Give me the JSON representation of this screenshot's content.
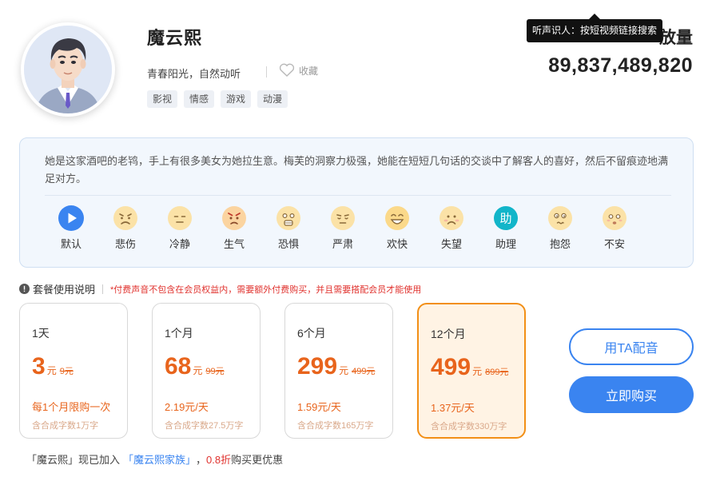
{
  "profile": {
    "name": "魔云熙",
    "tagline": "青春阳光，自然动听",
    "favorite_label": "收藏",
    "tags": [
      "影视",
      "情感",
      "游戏",
      "动漫"
    ]
  },
  "stats": {
    "plays_label": "放量",
    "plays_count": "89,837,489,820"
  },
  "tooltip": {
    "text": "听声识人：按短视频链接搜索"
  },
  "description": {
    "text": "她是这家酒吧的老鸨，手上有很多美女为她拉生意。梅芙的洞察力极强，她能在短短几句话的交谈中了解客人的喜好，然后不留痕迹地满足对方。"
  },
  "emotions": [
    {
      "label": "默认",
      "icon": "play-icon"
    },
    {
      "label": "悲伤",
      "icon": "sad-face-icon"
    },
    {
      "label": "冷静",
      "icon": "calm-face-icon"
    },
    {
      "label": "生气",
      "icon": "angry-face-icon"
    },
    {
      "label": "恐惧",
      "icon": "fear-face-icon"
    },
    {
      "label": "严肃",
      "icon": "serious-face-icon"
    },
    {
      "label": "欢快",
      "icon": "happy-face-icon"
    },
    {
      "label": "失望",
      "icon": "disappointed-face-icon"
    },
    {
      "label": "助理",
      "icon": "assistant-icon",
      "glyph": "助"
    },
    {
      "label": "抱怨",
      "icon": "complain-face-icon"
    },
    {
      "label": "不安",
      "icon": "uneasy-face-icon"
    }
  ],
  "package_notice": {
    "title": "套餐使用说明",
    "note": "*付费声音不包含在会员权益内，需要额外付费购买，并且需要搭配会员才能使用"
  },
  "plans": [
    {
      "name": "1天",
      "price": "3",
      "unit": "元",
      "original": "9元",
      "daily": "每1个月限购一次",
      "chars": "含合成字数1万字",
      "selected": false
    },
    {
      "name": "1个月",
      "price": "68",
      "unit": "元",
      "original": "99元",
      "daily": "2.19元/天",
      "chars": "含合成字数27.5万字",
      "selected": false
    },
    {
      "name": "6个月",
      "price": "299",
      "unit": "元",
      "original": "499元",
      "daily": "1.59元/天",
      "chars": "含合成字数165万字",
      "selected": false
    },
    {
      "name": "12个月",
      "price": "499",
      "unit": "元",
      "original": "899元",
      "daily": "1.37元/天",
      "chars": "含合成字数330万字",
      "selected": true
    }
  ],
  "actions": {
    "use_label": "用TA配音",
    "buy_label": "立即购买"
  },
  "family": {
    "prefix": "「魔云熙」现已加入",
    "link": "「魔云熙家族」",
    "comma": "，",
    "discount": "0.8折",
    "suffix": "购买更优惠"
  },
  "colors": {
    "accent_blue": "#3a84f0",
    "price_orange": "#e8641c",
    "selected_border": "#f28f16",
    "notice_red": "#e0322e"
  }
}
